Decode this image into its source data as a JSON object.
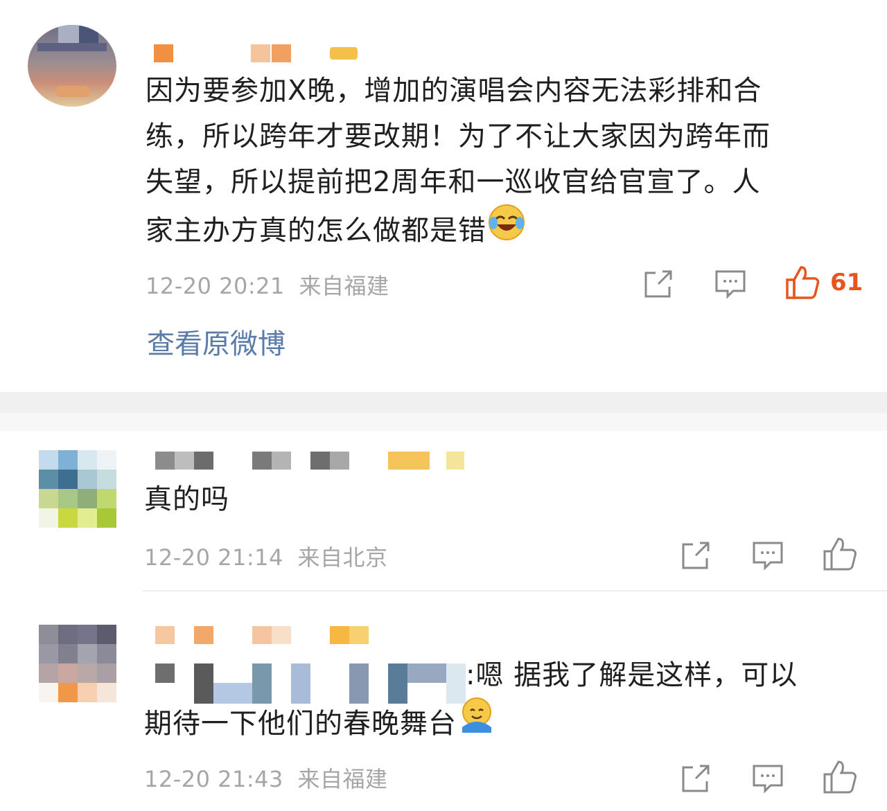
{
  "comments": [
    {
      "text_line1": "因为要参加X晚，增加的演唱会内容无法彩排和合",
      "text_line2": "练，所以跨年才要改期！为了不让大家因为跨年而",
      "text_line3": "失望，所以提前把2周年和一巡收官给官宣了。人",
      "text_line4": "家主办方真的怎么做都是错",
      "time": "12-20 20:21",
      "location": "来自福建",
      "likes": "61",
      "liked": true,
      "view_original": "查看原微博"
    },
    {
      "text_line1": "真的吗",
      "time": "12-20 21:14",
      "location": "来自北京"
    },
    {
      "text_line1_suffix": ":嗯 据我了解是这样，可以",
      "text_line2": "期待一下他们的春晚舞台",
      "time": "12-20 21:43",
      "location": "来自福建"
    }
  ],
  "icons": {
    "share": "share-icon",
    "comment": "comment-icon",
    "like": "thumbs-up-icon",
    "emoji_laugh": "laughing-tears-emoji-icon",
    "emoji_hug": "hug-emoji-icon"
  },
  "colors": {
    "liked": "#e8551c",
    "link": "#5a7ba8",
    "meta": "#a6a6a6"
  }
}
